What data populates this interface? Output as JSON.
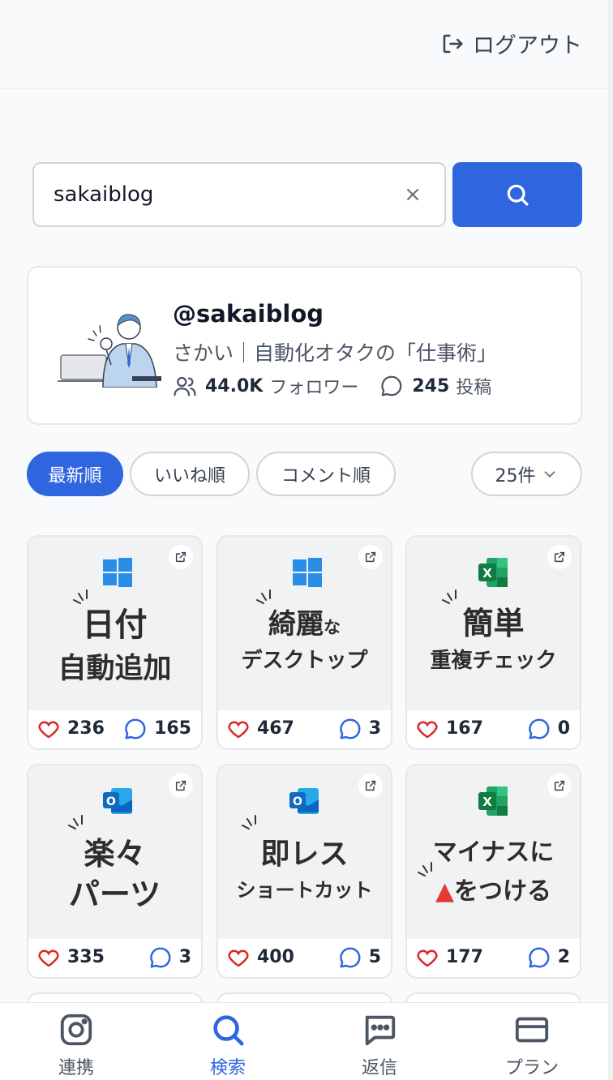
{
  "header": {
    "logout_label": "ログアウト"
  },
  "search": {
    "value": "sakaiblog",
    "clear_label": "×"
  },
  "profile": {
    "handle": "@sakaiblog",
    "display_name": "さかい｜自動化オタクの「仕事術」",
    "followers": "44.0K",
    "followers_label": "フォロワー",
    "posts": "245",
    "posts_label": "投稿"
  },
  "sort": {
    "options": [
      "最新順",
      "いいね順",
      "コメント順"
    ],
    "active": "最新順",
    "count_label": "25件"
  },
  "posts": [
    {
      "app": "windows",
      "line1": "日付",
      "line1_suffix": "",
      "line2": "自動追加",
      "likes": "236",
      "comments": "165"
    },
    {
      "app": "windows",
      "line1": "綺麗",
      "line1_suffix": "な",
      "line2": "デスクトップ",
      "likes": "467",
      "comments": "3"
    },
    {
      "app": "excel",
      "line1": "簡単",
      "line1_suffix": "",
      "line2": "重複チェック",
      "likes": "167",
      "comments": "0"
    },
    {
      "app": "outlook",
      "line1": "楽々",
      "line1_suffix": "",
      "line2": "パーツ",
      "likes": "335",
      "comments": "3"
    },
    {
      "app": "outlook",
      "line1": "即レス",
      "line1_suffix": "",
      "line2": "ショートカット",
      "likes": "400",
      "comments": "5"
    },
    {
      "app": "excel",
      "line1": "マイナスに",
      "line1_suffix": "",
      "line2_marker": "▲",
      "line2": "をつける",
      "likes": "177",
      "comments": "2"
    }
  ],
  "nav": {
    "items": [
      {
        "label": "連携",
        "icon": "instagram-icon"
      },
      {
        "label": "検索",
        "icon": "search-icon"
      },
      {
        "label": "返信",
        "icon": "chat-icon"
      },
      {
        "label": "プラン",
        "icon": "credit-card-icon"
      }
    ],
    "active": "検索"
  },
  "colors": {
    "accent": "#2f66e0",
    "like": "#dc2626",
    "comment": "#2f66e0"
  }
}
